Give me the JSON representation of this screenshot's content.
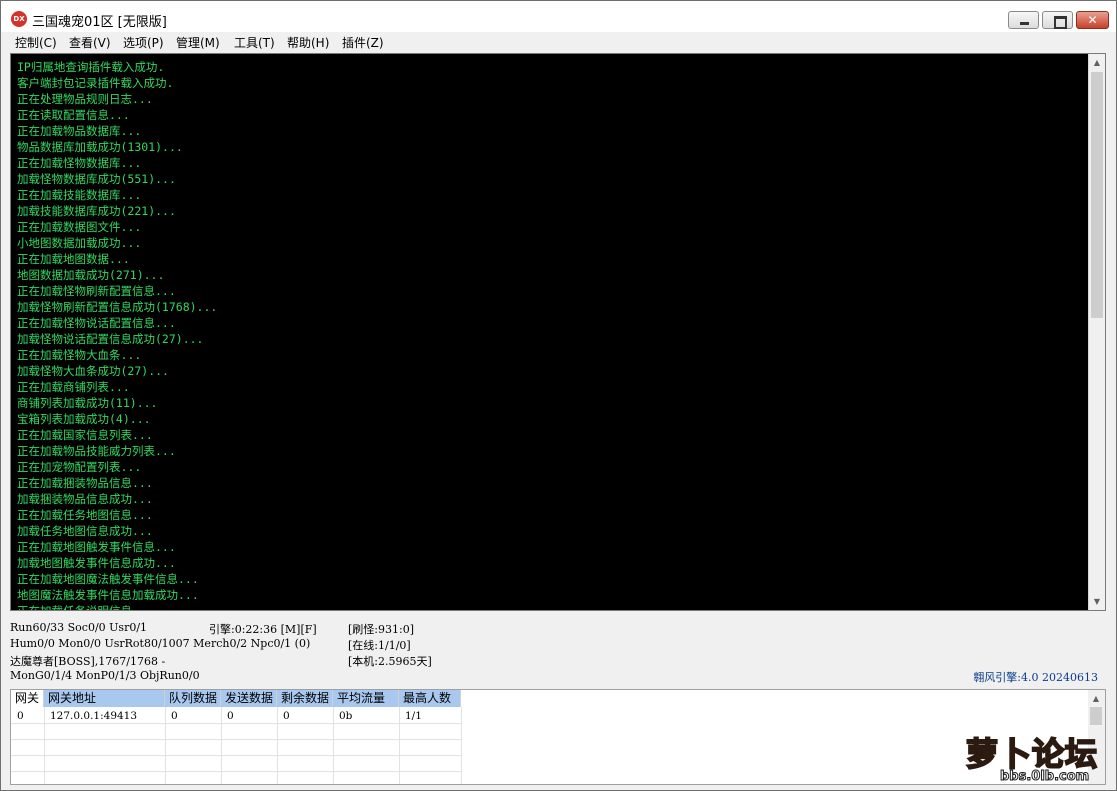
{
  "window": {
    "title": "三国魂宠01区 [无限版]",
    "icon_text": "DX",
    "close_glyph": "✕"
  },
  "menu": [
    {
      "label": "控制(C)"
    },
    {
      "label": "查看(V)"
    },
    {
      "label": "选项(P)"
    },
    {
      "label": "管理(M)"
    },
    {
      "label": "工具(T)"
    },
    {
      "label": "帮助(H)"
    },
    {
      "label": "插件(Z)"
    }
  ],
  "console": {
    "text_color": "#33d860",
    "lines": [
      "IP归属地查询插件载入成功.",
      "客户端封包记录插件载入成功.",
      "正在处理物品规则日志...",
      "正在读取配置信息...",
      "正在加载物品数据库...",
      "物品数据库加载成功(1301)...",
      "正在加载怪物数据库...",
      "加载怪物数据库成功(551)...",
      "正在加载技能数据库...",
      "加载技能数据库成功(221)...",
      "正在加载数据图文件...",
      "小地图数据加载成功...",
      "正在加载地图数据...",
      "地图数据加载成功(271)...",
      "正在加载怪物刷新配置信息...",
      "加载怪物刷新配置信息成功(1768)...",
      "正在加载怪物说话配置信息...",
      "加载怪物说话配置信息成功(27)...",
      "正在加载怪物大血条...",
      "加载怪物大血条成功(27)...",
      "正在加载商铺列表...",
      "商铺列表加载成功(11)...",
      "宝箱列表加载成功(4)...",
      "正在加载国家信息列表...",
      "正在加载物品技能威力列表...",
      "正在加宠物配置列表...",
      "正在加载捆装物品信息...",
      "加载捆装物品信息成功...",
      "正在加载任务地图信息...",
      "加载任务地图信息成功...",
      "正在加载地图触发事件信息...",
      "加载地图触发事件信息成功...",
      "正在加载地图魔法触发事件信息...",
      "地图魔法触发事件信息加载成功...",
      "正在加载任务说明信息..."
    ]
  },
  "status": {
    "run": "Run60/33 Soc0/0 Usr0/1",
    "engine_time": "引擎:0:22:36 [M][F]",
    "refresh": "[刷怪:931:0]",
    "hum": "Hum0/0 Mon0/0 UsrRot80/1007 Merch0/2 Npc0/1 (0)",
    "online": "[在线:1/1/0]",
    "boss": "达魔尊者[BOSS],1767/1768 -",
    "uptime": "[本机:2.5965天]",
    "mon": "MonG0/1/4 MonP0/1/3 ObjRun0/0",
    "engine_version": "翱风引擎:4.0 20240613"
  },
  "gateway": {
    "columns": [
      "网关",
      "网关地址",
      "队列数据",
      "发送数据",
      "剩余数据",
      "平均流量",
      "最高人数"
    ],
    "rows": [
      [
        "0",
        "127.0.0.1:49413",
        "0",
        "0",
        "0",
        "0b",
        "1/1"
      ]
    ]
  },
  "watermark": {
    "logo_text": "萝卜论坛",
    "url": "bbs.0lb.com"
  }
}
